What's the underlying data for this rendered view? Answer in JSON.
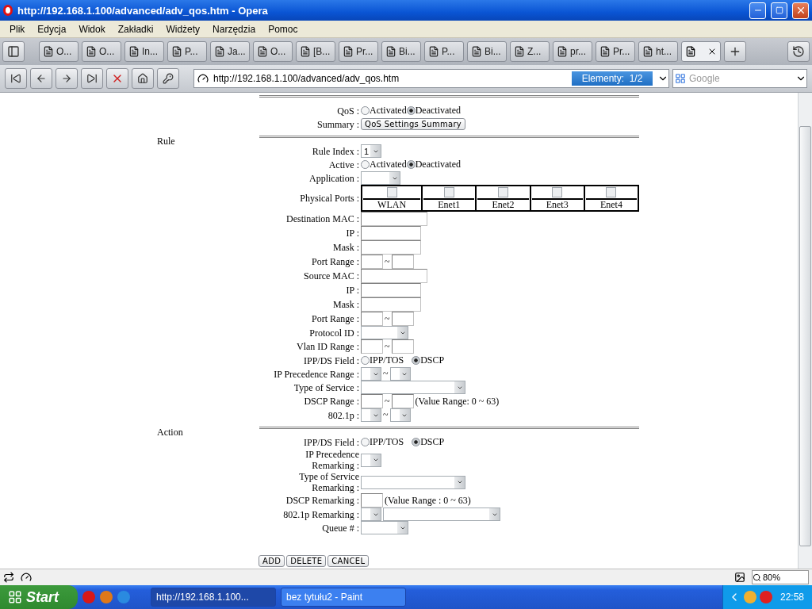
{
  "window": {
    "title": "http://192.168.1.100/advanced/adv_qos.htm - Opera"
  },
  "menu": [
    "Plik",
    "Edycja",
    "Widok",
    "Zakładki",
    "Widżety",
    "Narzędzia",
    "Pomoc"
  ],
  "tabs": [
    {
      "label": "O...",
      "selected": false
    },
    {
      "label": "O...",
      "selected": false
    },
    {
      "label": "In...",
      "selected": false
    },
    {
      "label": "P...",
      "selected": false
    },
    {
      "label": "Ja...",
      "selected": false
    },
    {
      "label": "O...",
      "selected": false
    },
    {
      "label": "[B...",
      "selected": false
    },
    {
      "label": "Pr...",
      "selected": false
    },
    {
      "label": "Bi...",
      "selected": false
    },
    {
      "label": "P...",
      "selected": false
    },
    {
      "label": "Bi...",
      "selected": false
    },
    {
      "label": "Z...",
      "selected": false
    },
    {
      "label": "pr...",
      "selected": false
    },
    {
      "label": "Pr...",
      "selected": false
    },
    {
      "label": "ht...",
      "selected": false
    },
    {
      "selected": true
    }
  ],
  "address_bar": {
    "url": "http://192.168.1.100/advanced/adv_qos.htm",
    "badge": "Elementy:  1/2"
  },
  "search": {
    "placeholder": "Google"
  },
  "sections": [
    {
      "rows": [
        {
          "label": "QoS :",
          "kind": "radio",
          "options": [
            {
              "label": "Activated",
              "selected": false
            },
            {
              "label": "Deactivated",
              "selected": true
            }
          ]
        },
        {
          "label": "Summary :",
          "kind": "button",
          "text": "QoS Settings Summary"
        }
      ]
    },
    {
      "title": "Rule",
      "rows": [
        {
          "label": "Rule Index :",
          "kind": "select-tiny",
          "value": "1"
        },
        {
          "label": "Active :",
          "kind": "radio",
          "options": [
            {
              "label": "Activated",
              "selected": false
            },
            {
              "label": "Deactivated",
              "selected": true
            }
          ]
        },
        {
          "label": "Application :",
          "kind": "select-short"
        },
        {
          "label": "Physical Ports :",
          "kind": "ports",
          "ports": [
            {
              "label": "WLAN",
              "checked": false
            },
            {
              "label": "Enet1",
              "checked": false
            },
            {
              "label": "Enet2",
              "checked": false
            },
            {
              "label": "Enet3",
              "checked": false
            },
            {
              "label": "Enet4",
              "checked": false
            }
          ]
        },
        {
          "label": "Destination MAC :",
          "kind": "text-long"
        },
        {
          "label": "IP :",
          "kind": "text-medium"
        },
        {
          "label": "Mask :",
          "kind": "text-medium"
        },
        {
          "label": "Port Range :",
          "kind": "text-range",
          "separator": "~"
        },
        {
          "label": "Source MAC :",
          "kind": "text-long"
        },
        {
          "label": "IP :",
          "kind": "text-medium"
        },
        {
          "label": "Mask :",
          "kind": "text-medium"
        },
        {
          "label": "Port Range :",
          "kind": "text-range",
          "separator": "~"
        },
        {
          "label": "Protocol ID :",
          "kind": "select-medium"
        },
        {
          "label": "Vlan ID Range :",
          "kind": "text-range",
          "separator": "~"
        },
        {
          "label": "IPP/DS Field :",
          "kind": "radio",
          "options": [
            {
              "label": "IPP/TOS",
              "selected": false
            },
            {
              "label": "DSCP",
              "selected": true
            }
          ]
        },
        {
          "label": "IP Precedence Range :",
          "kind": "select-range",
          "separator": "~"
        },
        {
          "label": "Type of Service :",
          "kind": "select-wide"
        },
        {
          "label": "DSCP Range :",
          "kind": "text-range",
          "separator": "~",
          "note": "(Value Range: 0 ~ 63)"
        },
        {
          "label": "802.1p :",
          "kind": "select-range",
          "separator": "~"
        }
      ]
    },
    {
      "title": "Action",
      "rows": [
        {
          "label": "IPP/DS Field :",
          "kind": "radio",
          "options": [
            {
              "label": "IPP/TOS",
              "selected": false
            },
            {
              "label": "DSCP",
              "selected": true
            }
          ]
        },
        {
          "label": "IP Precedence\nRemarking :",
          "kind": "select-tiny"
        },
        {
          "label": "Type of Service\nRemarking :",
          "kind": "select-wide"
        },
        {
          "label": "DSCP Remarking :",
          "kind": "text-short",
          "note": "(Value Range : 0 ~ 63)"
        },
        {
          "label": "802.1p Remarking :",
          "kind": "select-pair"
        },
        {
          "label": "Queue # :",
          "kind": "select-medium"
        }
      ]
    }
  ],
  "buttons": [
    "ADD",
    "DELETE",
    "CANCEL"
  ],
  "status_bar": {
    "zoom": "80%"
  },
  "taskbar": {
    "start": "Start",
    "tasks": [
      {
        "label": "http://192.168.1.100...",
        "selected": true
      },
      {
        "label": "bez tytułu2 - Paint",
        "selected": false
      }
    ],
    "clock": "22:58"
  }
}
